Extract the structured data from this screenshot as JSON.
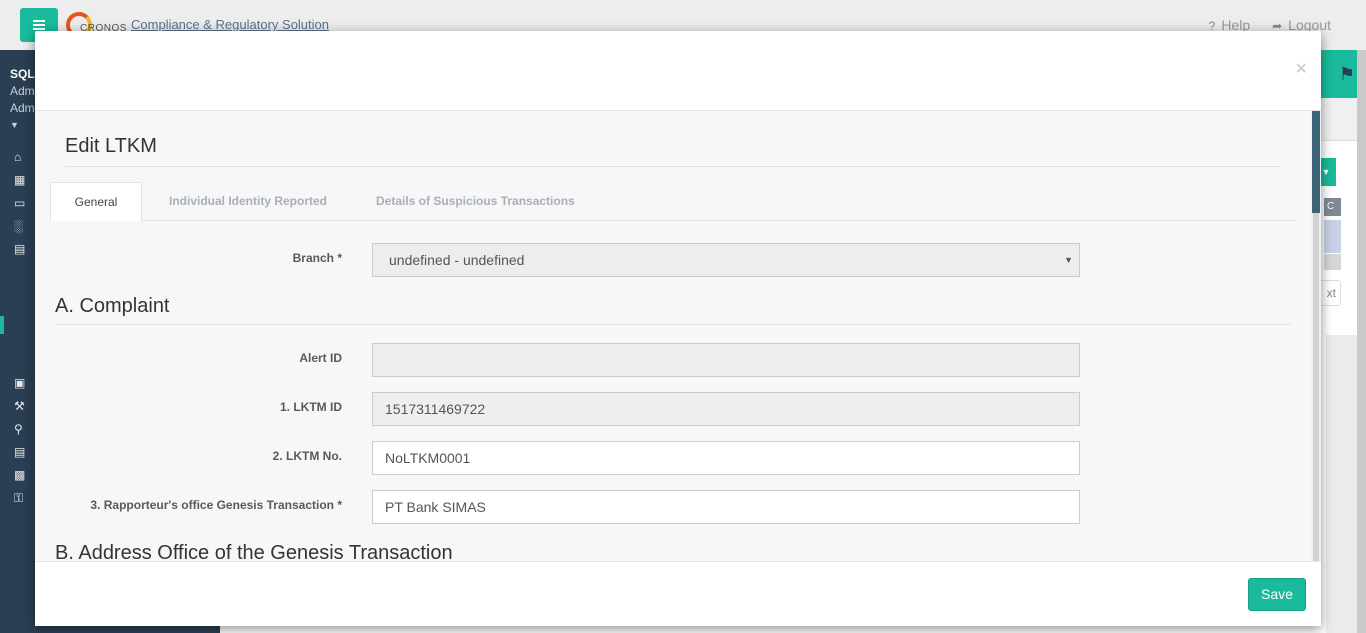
{
  "app": {
    "logo_text": "CRONOS",
    "title": "Compliance & Regulatory Solution",
    "help": "Help",
    "logout": "Logout"
  },
  "sidebar": {
    "user_name": "SQL",
    "user_line2": "Adm",
    "user_line3": "Adm"
  },
  "background": {
    "right_col_header": "C",
    "right_next": "xt"
  },
  "modal": {
    "close": "×",
    "form_title": "Edit LTKM",
    "tabs": [
      {
        "label": "General",
        "active": true
      },
      {
        "label": "Individual Identity Reported",
        "active": false
      },
      {
        "label": "Details of Suspicious Transactions",
        "active": false
      }
    ],
    "branch": {
      "label": "Branch *",
      "value": "undefined - undefined"
    },
    "section_a": "A. Complaint",
    "fields": [
      {
        "label": "Alert ID",
        "value": ""
      },
      {
        "label": "1. LKTM ID",
        "value": "1517311469722"
      },
      {
        "label": "2. LKTM No.",
        "value": "NoLTKM0001"
      },
      {
        "label": "3. Rapporteur's office Genesis Transaction *",
        "value": "PT Bank SIMAS"
      }
    ],
    "section_b": "B. Address Office of the Genesis Transaction",
    "save": "Save"
  },
  "colors": {
    "accent": "#1abb9c",
    "sidebar": "#2a3f54"
  }
}
